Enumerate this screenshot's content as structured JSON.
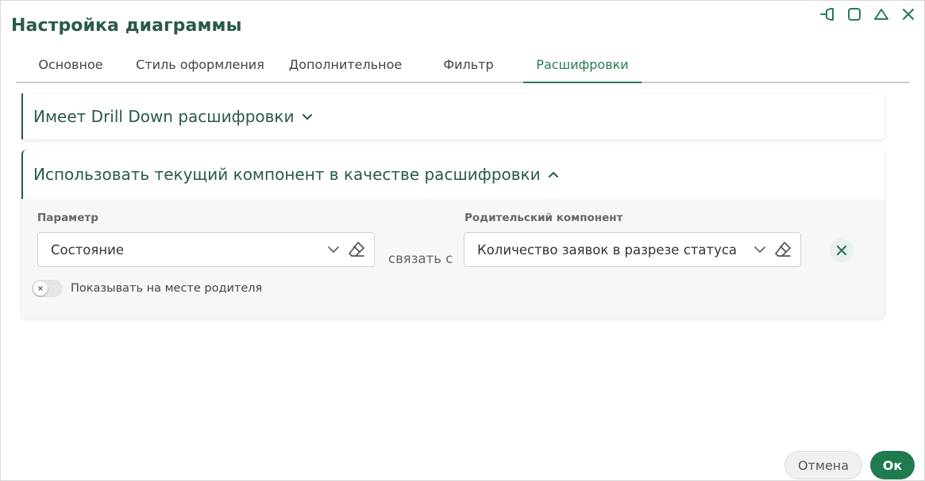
{
  "dialog": {
    "title": "Настройка диаграммы",
    "window_controls": [
      "pin-icon",
      "maximize-icon",
      "collapse-icon",
      "close-icon"
    ]
  },
  "tabs": [
    {
      "label": "Основное",
      "active": false
    },
    {
      "label": "Стиль оформления",
      "active": false
    },
    {
      "label": "Дополнительное",
      "active": false
    },
    {
      "label": "Фильтр",
      "active": false
    },
    {
      "label": "Расшифровки",
      "active": true
    }
  ],
  "sections": {
    "drill_down": {
      "title": "Имеет Drill Down расшифровки",
      "expanded": false
    },
    "use_current": {
      "title": "Использовать текущий компонент в качестве расшифровки",
      "expanded": true,
      "parameter_label": "Параметр",
      "parameter_value": "Состояние",
      "link_text": "связать с",
      "parent_label": "Родительский компонент",
      "parent_value": "Количество заявок в разрезе статуса",
      "toggle_label": "Показывать на месте родителя",
      "toggle_on": false
    }
  },
  "footer": {
    "cancel_label": "Отмена",
    "ok_label": "Ок"
  },
  "colors": {
    "accent": "#2a5a48",
    "primary_button": "#1f7a4d",
    "active_tab": "#2a7a55"
  }
}
